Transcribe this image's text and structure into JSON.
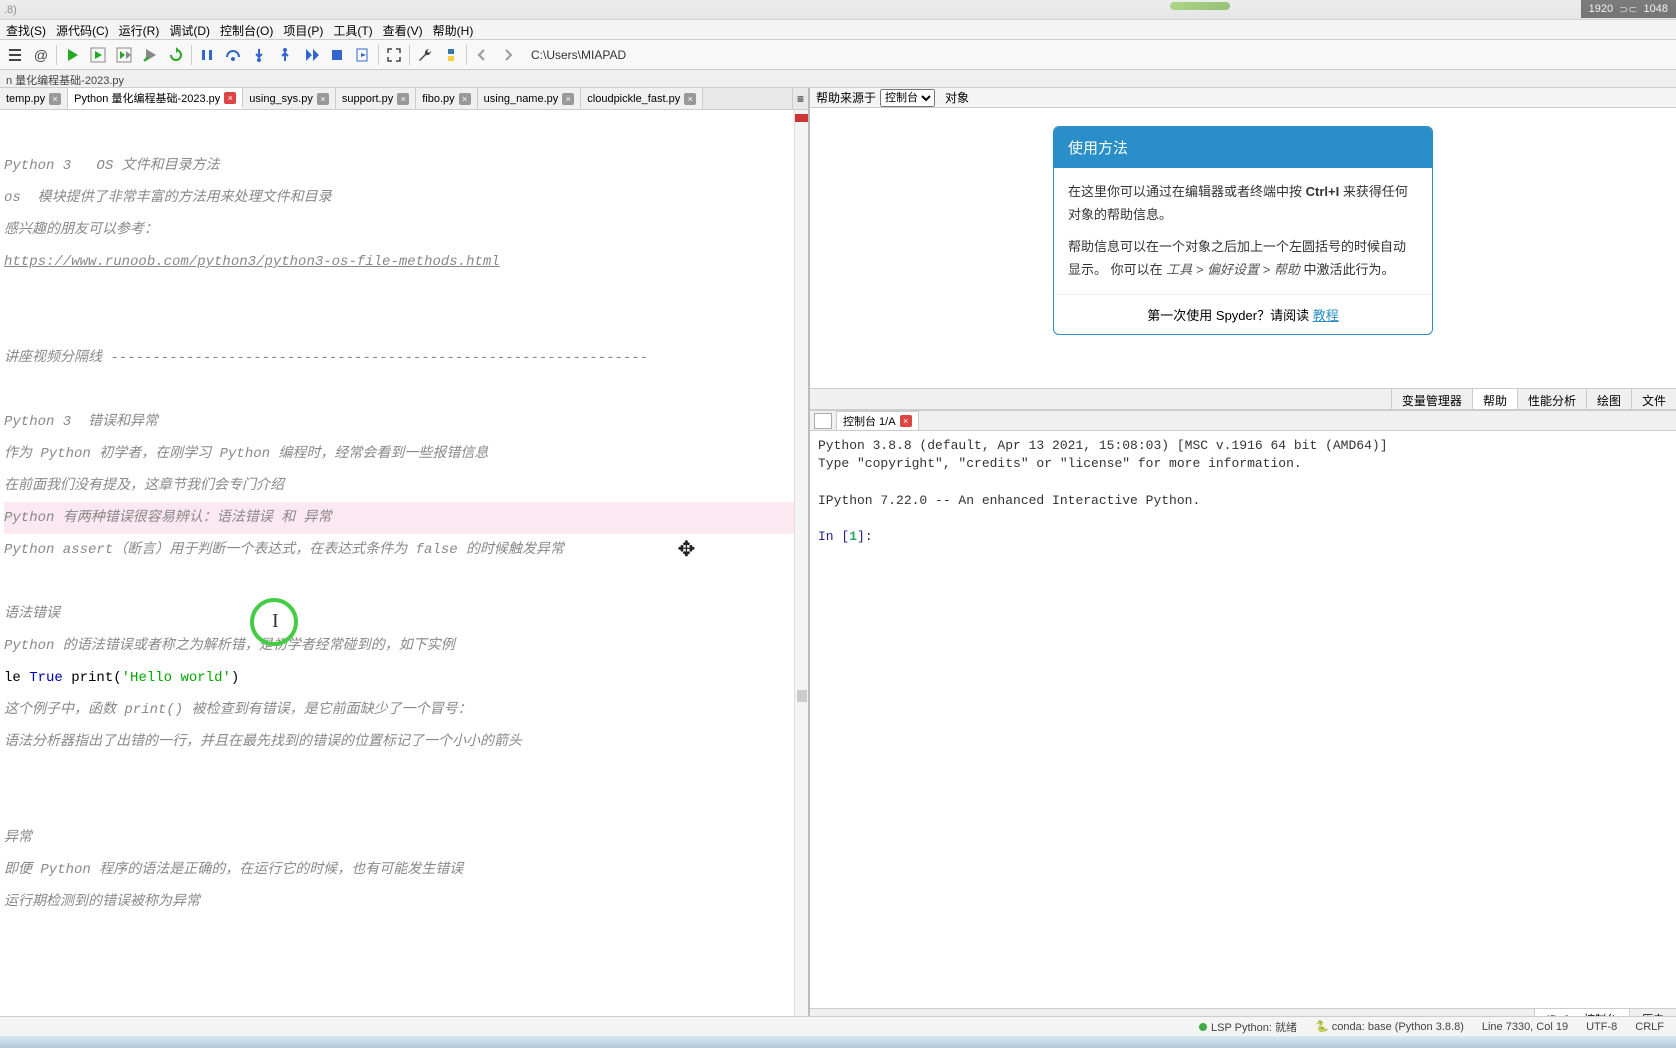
{
  "titlebar": ".8)",
  "resolution": {
    "w": "1920",
    "h": "1048"
  },
  "menu": {
    "search": "查找(S)",
    "source": "源代码(C)",
    "run": "运行(R)",
    "debug": "调试(D)",
    "console": "控制台(O)",
    "project": "项目(P)",
    "tools": "工具(T)",
    "view": "查看(V)",
    "help": "帮助(H)"
  },
  "toolbar": {
    "path": "C:\\Users\\MIAPAD"
  },
  "filepath": "n 量化编程基础-2023.py",
  "tabs": {
    "t0": "temp.py",
    "t1": "Python 量化编程基础-2023.py",
    "t2": "using_sys.py",
    "t3": "support.py",
    "t4": "fibo.py",
    "t5": "using_name.py",
    "t6": "cloudpickle_fast.py"
  },
  "code": {
    "l1": "Python 3   OS 文件和目录方法",
    "l2": "os  模块提供了非常丰富的方法用来处理文件和目录",
    "l3": "感兴趣的朋友可以参考：",
    "l4": "https://www.runoob.com/python3/python3-os-file-methods.html",
    "l5": "讲座视频分隔线 ----------------------------------------------------------------",
    "l6": "Python 3  错误和异常",
    "l7": "作为 Python 初学者，在刚学习 Python 编程时，经常会看到一些报错信息",
    "l8": "在前面我们没有提及，这章节我们会专门介绍",
    "l9": "Python 有两种错误很容易辨认：语法错误 和 异常",
    "l10": "Python assert（断言）用于判断一个表达式，在表达式条件为 false 的时候触发异常",
    "l11": "语法错误",
    "l12": "Python 的语法错误或者称之为解析错，是初学者经常碰到的，如下实例",
    "l13a": "le ",
    "l13b": "True",
    "l13c": " print",
    "l13d": "(",
    "l13e": "'Hello world'",
    "l13f": ")",
    "l14": "这个例子中，函数 print() 被检查到有错误，是它前面缺少了一个冒号：",
    "l15": "语法分析器指出了出错的一行，并且在最先找到的错误的位置标记了一个小小的箭头",
    "l16": "异常",
    "l17": "即便 Python 程序的语法是正确的，在运行它的时候，也有可能发生错误",
    "l18": "运行期检测到的错误被称为异常"
  },
  "help": {
    "src_label": "帮助来源于",
    "src_select": "控制台",
    "obj_label": "对象",
    "card_title": "使用方法",
    "body1a": "在这里你可以通过在编辑器或者终端中按 ",
    "body1b": "Ctrl+I",
    "body1c": " 来获得任何对象的帮助信息。",
    "body2a": "帮助信息可以在一个对象之后加上一个左圆括号的时候自动显示。 你可以在 ",
    "body2b": "工具 > 偏好设置 > 帮助",
    "body2c": " 中激活此行为。",
    "foot_a": "第一次使用 Spyder？请阅读 ",
    "foot_link": "教程"
  },
  "right_tabs": {
    "t0": "变量管理器",
    "t1": "帮助",
    "t2": "性能分析",
    "t3": "绘图",
    "t4": "文件"
  },
  "console": {
    "tab": "控制台 1/A",
    "line1": "Python 3.8.8 (default, Apr 13 2021, 15:08:03) [MSC v.1916 64 bit (AMD64)]",
    "line2": "Type \"copyright\", \"credits\" or \"license\" for more information.",
    "line3": "IPython 7.22.0 -- An enhanced Interactive Python.",
    "prompt_in": "In [",
    "prompt_n": "1",
    "prompt_end": "]: "
  },
  "console_bottom": {
    "t0": "IPython控制台",
    "t1": "历史"
  },
  "status": {
    "lsp": "LSP Python: 就绪",
    "conda": "conda: base (Python 3.8.8)",
    "line": "Line 7330, Col 19",
    "enc": "UTF-8",
    "eol": "CRLF"
  }
}
